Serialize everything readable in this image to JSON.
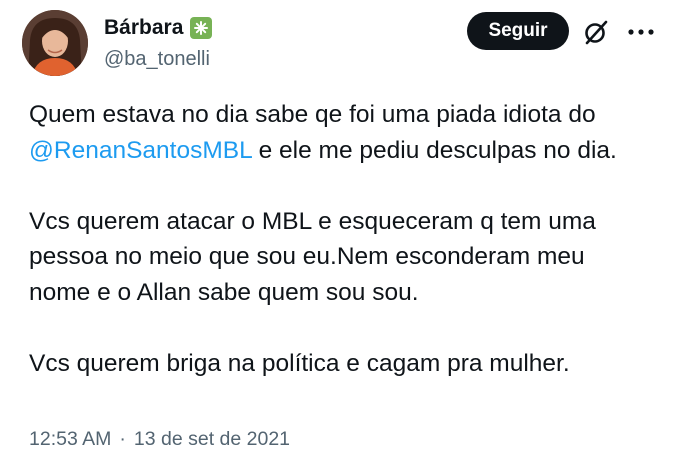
{
  "author": {
    "display_name": "Bárbara",
    "handle": "@ba_tonelli",
    "badge_icon": "sparkle-emoji-icon",
    "badge_color": "#77b255"
  },
  "actions": {
    "follow_label": "Seguir",
    "grok_icon": "grok-icon",
    "more_icon": "more-horizontal-icon"
  },
  "tweet": {
    "line1_pre": "Quem estava no dia sabe qe foi uma piada idiota do",
    "mention": "@RenanSantosMBL",
    "line1_post": " e ele me pediu desculpas no dia.",
    "para2_line1": "Vcs querem atacar o MBL e  esqueceram q tem uma",
    "para2_line2": "pessoa no meio que sou eu.Nem esconderam meu",
    "para2_line3": "nome e o Allan sabe quem sou sou.",
    "para3": "Vcs querem briga na política e cagam pra mulher."
  },
  "meta": {
    "time": "12:53 AM",
    "separator": "·",
    "date": "13 de set de 2021"
  },
  "colors": {
    "text": "#0f1419",
    "secondary": "#536471",
    "link": "#1d9bf0",
    "button_bg": "#0f1419"
  }
}
